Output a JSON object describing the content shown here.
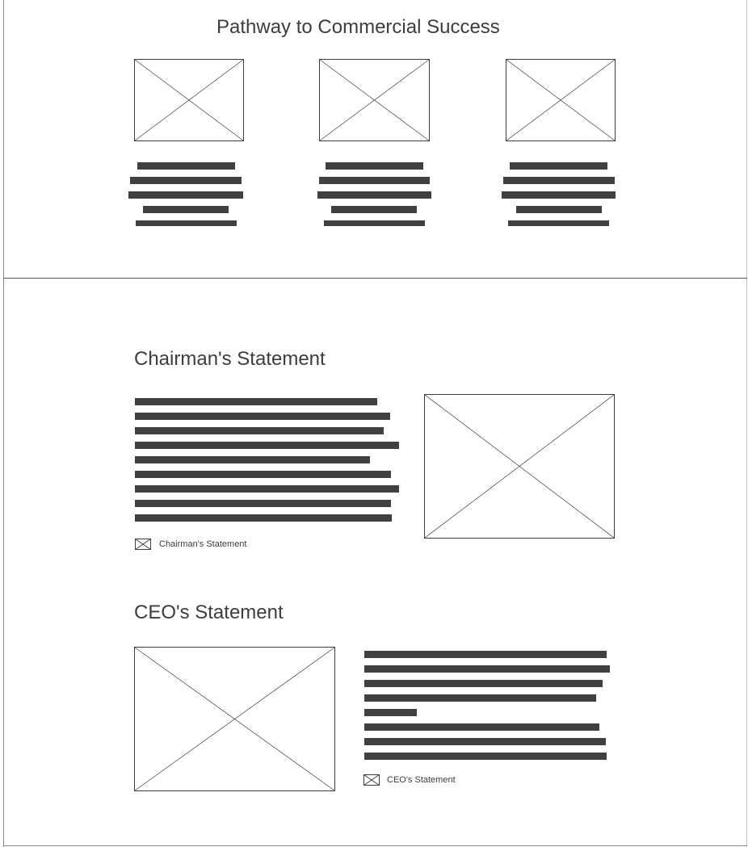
{
  "pathway": {
    "title": "Pathway to Commercial Success"
  },
  "chairman": {
    "title": "Chairman's Statement",
    "link_label": "Chairman's Statement"
  },
  "ceo": {
    "title": "CEO's Statement",
    "link_label": "CEO's Statement"
  },
  "icons": {
    "placeholder": "image-placeholder-icon",
    "link": "envelope-icon"
  },
  "colors": {
    "text": "#3d3d3d",
    "bar": "#404040",
    "border": "#3d3d3d"
  }
}
